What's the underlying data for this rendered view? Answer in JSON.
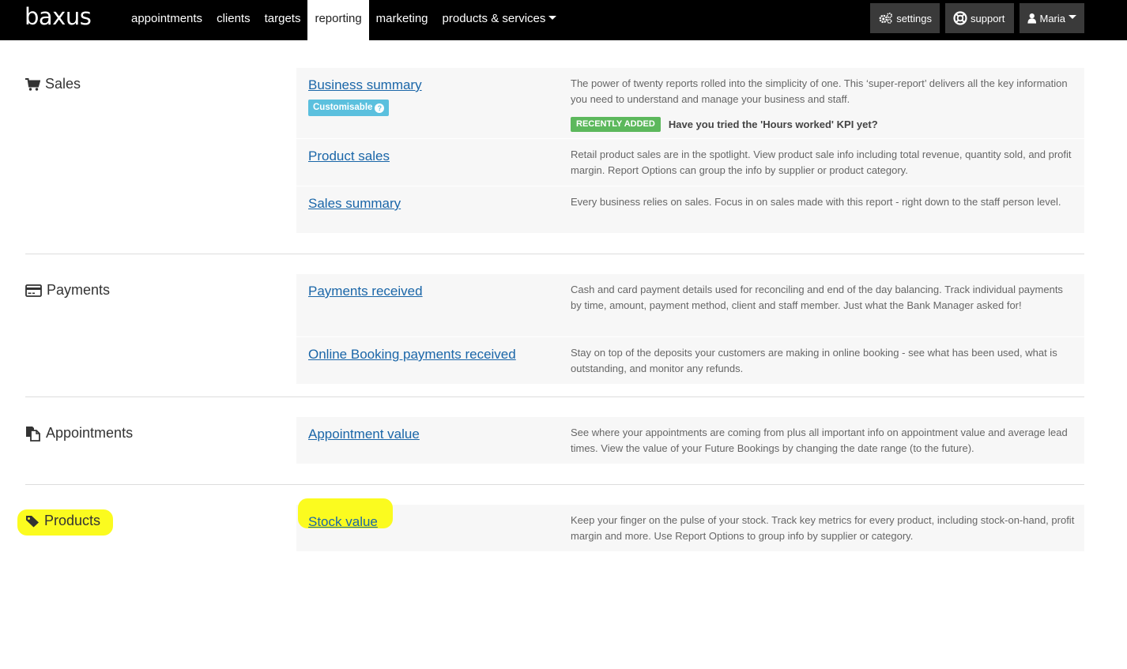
{
  "brand": {
    "logo": "baxus"
  },
  "nav": {
    "items": [
      {
        "label": "appointments"
      },
      {
        "label": "clients"
      },
      {
        "label": "targets"
      },
      {
        "label": "reporting",
        "active": true
      },
      {
        "label": "marketing"
      },
      {
        "label": "products & services",
        "dropdown": true
      }
    ]
  },
  "header_right": {
    "settings_label": "settings",
    "support_label": "support",
    "user_label": "Maria"
  },
  "sections": [
    {
      "title": "Sales",
      "icon": "shopping-cart-icon",
      "reports": [
        {
          "name": "Business summary",
          "badge": "Customisable",
          "description": "The power of twenty reports rolled into the simplicity of one. This ‘super-report’ delivers all the key information you need to understand and manage your business and staff.",
          "new_badge": "RECENTLY ADDED",
          "new_text": "Have you tried the 'Hours worked' KPI yet?"
        },
        {
          "name": "Product sales",
          "description": "Retail product sales are in the spotlight. View product sale info including total revenue, quantity sold, and profit margin. Report Options can group the info by supplier or product category."
        },
        {
          "name": "Sales summary",
          "description": "Every business relies on sales. Focus in on sales made with this report - right down to the staff person level."
        }
      ]
    },
    {
      "title": "Payments",
      "icon": "credit-card-icon",
      "reports": [
        {
          "name": "Payments received",
          "description": "Cash and card payment details used for reconciling and end of the day balancing. Track individual payments by time, amount, payment method, client and staff member. Just what the Bank Manager asked for!"
        },
        {
          "name": "Online Booking payments received",
          "description": "Stay on top of the deposits your customers are making in online booking - see what has been used, what is outstanding, and monitor any refunds."
        }
      ]
    },
    {
      "title": "Appointments",
      "icon": "copy-icon",
      "reports": [
        {
          "name": "Appointment value",
          "description": "See where your appointments are coming from plus all important info on appointment value and average lead times. View the value of your Future Bookings by changing the date range (to the future)."
        }
      ]
    },
    {
      "title": "Products",
      "icon": "tag-icon",
      "highlighted": true,
      "reports": [
        {
          "name": "Stock value",
          "highlighted": true,
          "description": "Keep your finger on the pulse of your stock. Track key metrics for every product, including stock-on-hand, profit margin and more. Use Report Options to group info by supplier or category."
        }
      ]
    }
  ],
  "colors": {
    "topbar_bg": "#000000",
    "link": "#1a66a8",
    "row_bg": "#f7f7f7",
    "badge_customisable": "#5bc0de",
    "badge_new": "#5cb85c",
    "highlight": "#fbfb1f"
  }
}
